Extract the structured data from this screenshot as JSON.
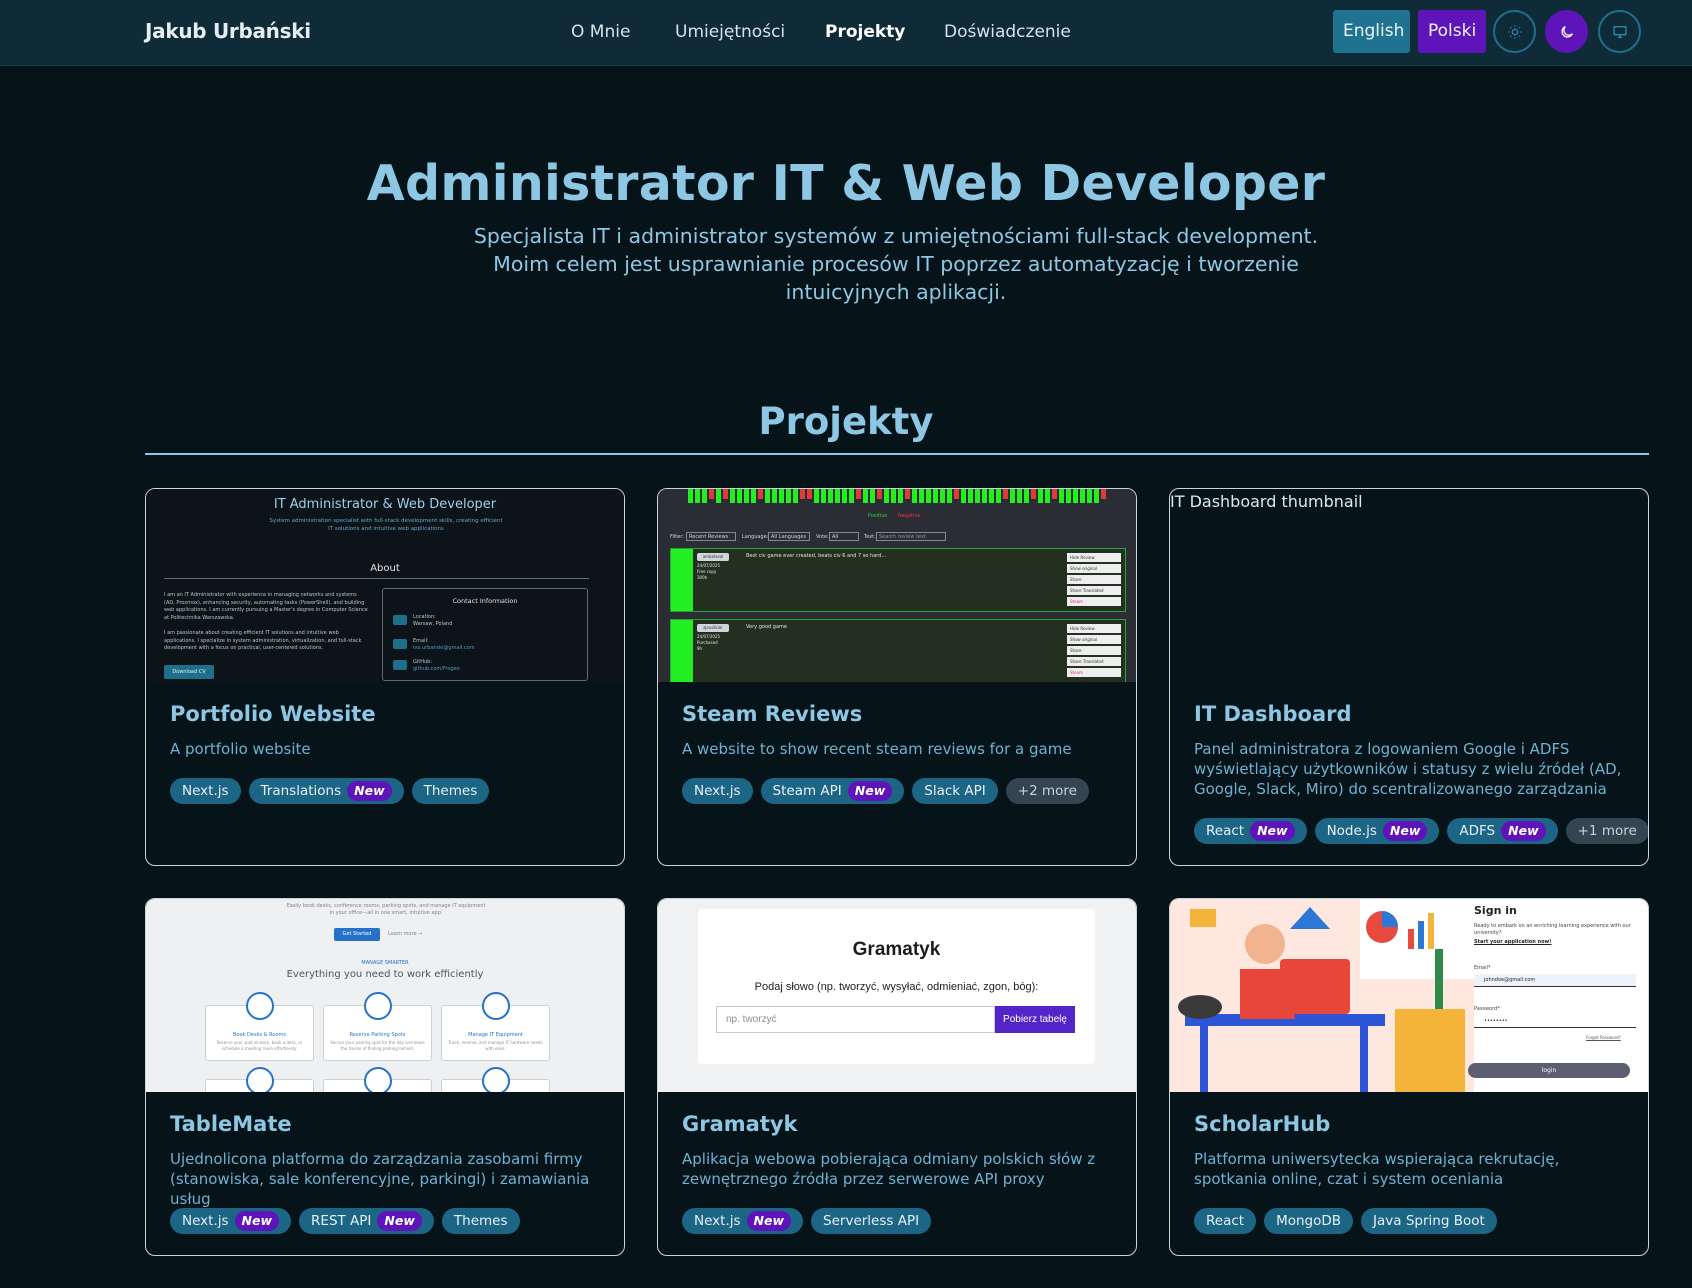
{
  "nav": {
    "brand": "Jakub Urbański",
    "links": [
      "O Mnie",
      "Umiejętności",
      "Projekty",
      "Doświadczenie"
    ],
    "active": "Projekty",
    "lang_en": "English",
    "lang_pl": "Polski",
    "theme_icons": [
      "sun-icon",
      "moon-icon",
      "monitor-icon"
    ]
  },
  "hero": {
    "title": "Administrator IT & Web Developer",
    "subtitle": "Specjalista IT i administrator systemów z umiejętnościami full-stack development. Moim celem jest usprawnianie procesów IT poprzez automatyzację i tworzenie intuicyjnych aplikacji."
  },
  "projects": {
    "heading": "Projekty",
    "new_label": "New",
    "cards": [
      {
        "title": "Portfolio Website",
        "description": "A portfolio website",
        "tags": [
          {
            "name": "Next.js",
            "new": false
          },
          {
            "name": "Translations",
            "new": true
          },
          {
            "name": "Themes",
            "new": false
          }
        ],
        "more": "",
        "thumb": {
          "title": "IT Administrator & Web Developer",
          "subtitle": "System administration specialist with full-stack development skills, creating efficient IT solutions and intuitive web applications",
          "about": "About",
          "about_text_1": "I am an IT Administrator with experience in managing networks and systems (AD, Proxmox), enhancing security, automating tasks (PowerShell), and building web applications. I am currently pursuing a Master's degree in Computer Science at Politechnika Warszawska.",
          "about_text_2": "I am passionate about creating efficient IT solutions and intuitive web applications. I specialize in system administration, virtualization, and full-stack development with a focus on practical, user-centered solutions.",
          "download": "Download CV",
          "contact_title": "Contact Information",
          "location_label": "Location:",
          "location": "Warsaw, Poland",
          "email_label": "Email:",
          "email": "ivo.urbanski@gmail.com",
          "github_label": "GitHub:",
          "github": "github.com/Frogeo"
        }
      },
      {
        "title": "Steam Reviews",
        "description": "A website to show recent steam reviews for a game",
        "tags": [
          {
            "name": "Next.js",
            "new": false
          },
          {
            "name": "Steam API",
            "new": true
          },
          {
            "name": "Slack API",
            "new": false
          }
        ],
        "more": "+2 more",
        "thumb": {
          "legend_pos": "Positive",
          "legend_neg": "Negative",
          "filter": "Filter:",
          "filter_val": "Recent Reviews",
          "language": "Language:",
          "language_val": "All Languages",
          "vote": "Vote:",
          "vote_val": "All",
          "text": "Text:",
          "search_ph": "Search review text",
          "review1_user": "ambelseal",
          "review1_date": "24/07/2025",
          "review1_type": "Free copy",
          "review1_hours": "300h",
          "review1_text": "Best civ game ever created, beats civ 6 and 7 so hard...",
          "review2_user": "zjaxsilkier",
          "review2_date": "24/07/2025",
          "review2_type": "Purchased",
          "review2_hours": "9h",
          "review2_text": "Very good game",
          "actions": [
            "Hide Review",
            "Show original",
            "Share",
            "Share Translated",
            "Steam"
          ]
        }
      },
      {
        "title": "IT Dashboard",
        "description": "Panel administratora z logowaniem Google i ADFS wyświetlający użytkowników i statusy z wielu źródeł (AD, Google, Slack, Miro) do scentralizowanego zarządzania",
        "tags": [
          {
            "name": "React",
            "new": true
          },
          {
            "name": "Node.js",
            "new": true
          },
          {
            "name": "ADFS",
            "new": true
          }
        ],
        "more": "+1 more",
        "thumb": {
          "alt": "IT Dashboard thumbnail"
        }
      },
      {
        "title": "TableMate",
        "description": "Ujednolicona platforma do zarządzania zasobami firmy (stanowiska, sale konferencyjne, parkingi) i zamawiania usług",
        "tags": [
          {
            "name": "Next.js",
            "new": true
          },
          {
            "name": "REST API",
            "new": true
          },
          {
            "name": "Themes",
            "new": false
          }
        ],
        "more": "",
        "thumb": {
          "top_text": "Easily book desks, conference rooms, parking spots, and manage IT equipment in your office—all in one smart, intuitive app.",
          "cta": "Get Started",
          "learn": "Learn more →",
          "eyebrow": "MANAGE SMARTER",
          "heading": "Everything you need to work efficiently",
          "features": [
            {
              "title": "Book Desks & Rooms",
              "text": "Reserve your spot at work, book a desk, or schedule a meeting room effortlessly."
            },
            {
              "title": "Reserve Parking Spots",
              "text": "Secure your parking spot for the day and leave the hassle of finding parking behind."
            },
            {
              "title": "Manage IT Equipment",
              "text": "Track, reserve, and manage IT hardware needs with ease."
            }
          ]
        }
      },
      {
        "title": "Gramatyk",
        "description": "Aplikacja webowa pobierająca odmiany polskich słów z zewnętrznego źródła przez serwerowe API proxy",
        "tags": [
          {
            "name": "Next.js",
            "new": true
          },
          {
            "name": "Serverless API",
            "new": false
          }
        ],
        "more": "",
        "thumb": {
          "title": "Gramatyk",
          "prompt": "Podaj słowo (np. tworzyć, wysyłać, odmieniać, zgon, bóg):",
          "placeholder": "np. tworzyć",
          "button": "Pobierz tabelę"
        }
      },
      {
        "title": "ScholarHub",
        "description": "Platforma uniwersytecka wspierająca rekrutację, spotkania online, czat i system oceniania",
        "tags": [
          {
            "name": "React",
            "new": false
          },
          {
            "name": "MongoDB",
            "new": false
          },
          {
            "name": "Java Spring Boot",
            "new": false
          }
        ],
        "more": "",
        "thumb": {
          "signin": "Sign in",
          "intro": "Ready to embark on an enriching learning experience with our university?",
          "start": "Start your application now!",
          "email_label": "Email*",
          "email_val": "johndoe@gmail.com",
          "password_label": "Password*",
          "password_val": "••••••••",
          "forgot": "Forgot Password?",
          "login": "login"
        }
      }
    ]
  },
  "colors": {
    "background": "#061419",
    "navbar": "#0f2b38",
    "accent": "#8ec7e4",
    "tag": "#1c6585",
    "new_badge": "#5e14b8",
    "english_button": "#1f7390"
  }
}
